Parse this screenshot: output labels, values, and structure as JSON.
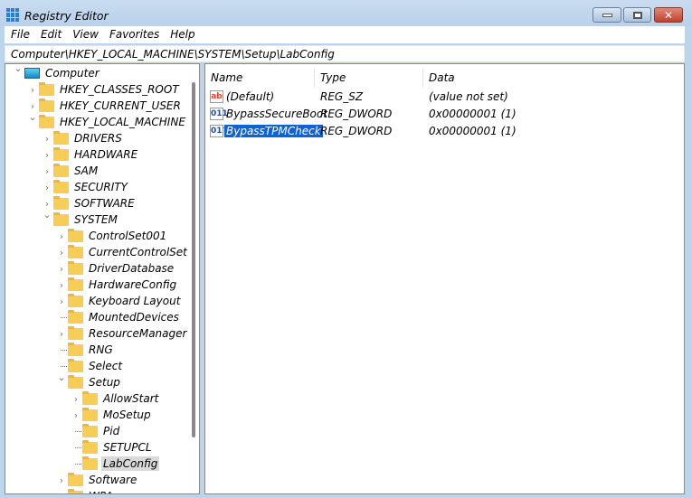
{
  "window": {
    "title": "Registry Editor",
    "minimize_icon": "minimize-icon",
    "maximize_icon": "maximize-icon",
    "close_icon": "close-icon"
  },
  "menu": [
    "File",
    "Edit",
    "View",
    "Favorites",
    "Help"
  ],
  "address": "Computer\\HKEY_LOCAL_MACHINE\\SYSTEM\\Setup\\LabConfig",
  "tree": [
    {
      "label": "Computer",
      "level": 0,
      "state": "expanded",
      "icon": "computer-icon"
    },
    {
      "label": "HKEY_CLASSES_ROOT",
      "level": 1,
      "state": "collapsed"
    },
    {
      "label": "HKEY_CURRENT_USER",
      "level": 1,
      "state": "collapsed"
    },
    {
      "label": "HKEY_LOCAL_MACHINE",
      "level": 1,
      "state": "expanded"
    },
    {
      "label": "DRIVERS",
      "level": 2,
      "state": "collapsed"
    },
    {
      "label": "HARDWARE",
      "level": 2,
      "state": "collapsed"
    },
    {
      "label": "SAM",
      "level": 2,
      "state": "collapsed"
    },
    {
      "label": "SECURITY",
      "level": 2,
      "state": "collapsed"
    },
    {
      "label": "SOFTWARE",
      "level": 2,
      "state": "collapsed"
    },
    {
      "label": "SYSTEM",
      "level": 2,
      "state": "expanded"
    },
    {
      "label": "ControlSet001",
      "level": 3,
      "state": "collapsed"
    },
    {
      "label": "CurrentControlSet",
      "level": 3,
      "state": "collapsed"
    },
    {
      "label": "DriverDatabase",
      "level": 3,
      "state": "collapsed"
    },
    {
      "label": "HardwareConfig",
      "level": 3,
      "state": "collapsed"
    },
    {
      "label": "Keyboard Layout",
      "level": 3,
      "state": "collapsed"
    },
    {
      "label": "MountedDevices",
      "level": 3,
      "state": "leaf"
    },
    {
      "label": "ResourceManager",
      "level": 3,
      "state": "collapsed"
    },
    {
      "label": "RNG",
      "level": 3,
      "state": "leaf"
    },
    {
      "label": "Select",
      "level": 3,
      "state": "leaf"
    },
    {
      "label": "Setup",
      "level": 3,
      "state": "expanded"
    },
    {
      "label": "AllowStart",
      "level": 4,
      "state": "collapsed"
    },
    {
      "label": "MoSetup",
      "level": 4,
      "state": "collapsed"
    },
    {
      "label": "Pid",
      "level": 4,
      "state": "leaf"
    },
    {
      "label": "SETUPCL",
      "level": 4,
      "state": "leaf"
    },
    {
      "label": "LabConfig",
      "level": 4,
      "state": "leaf",
      "selected": true
    },
    {
      "label": "Software",
      "level": 3,
      "state": "collapsed"
    },
    {
      "label": "WPA",
      "level": 3,
      "state": "collapsed"
    }
  ],
  "columns": {
    "name": "Name",
    "type": "Type",
    "data": "Data"
  },
  "values": [
    {
      "name": "(Default)",
      "type": "REG_SZ",
      "data": "(value not set)",
      "icon": "string-value-icon",
      "glyph": "ab",
      "color": "#d9452b"
    },
    {
      "name": "BypassSecureBoot",
      "type": "REG_DWORD",
      "data": "0x00000001 (1)",
      "icon": "binary-value-icon",
      "glyph": "011",
      "color": "#1f4fa0"
    },
    {
      "name": "BypassTPMCheck",
      "type": "REG_DWORD",
      "data": "0x00000001 (1)",
      "icon": "binary-value-icon",
      "glyph": "011",
      "color": "#1f4fa0",
      "selected": true
    }
  ]
}
